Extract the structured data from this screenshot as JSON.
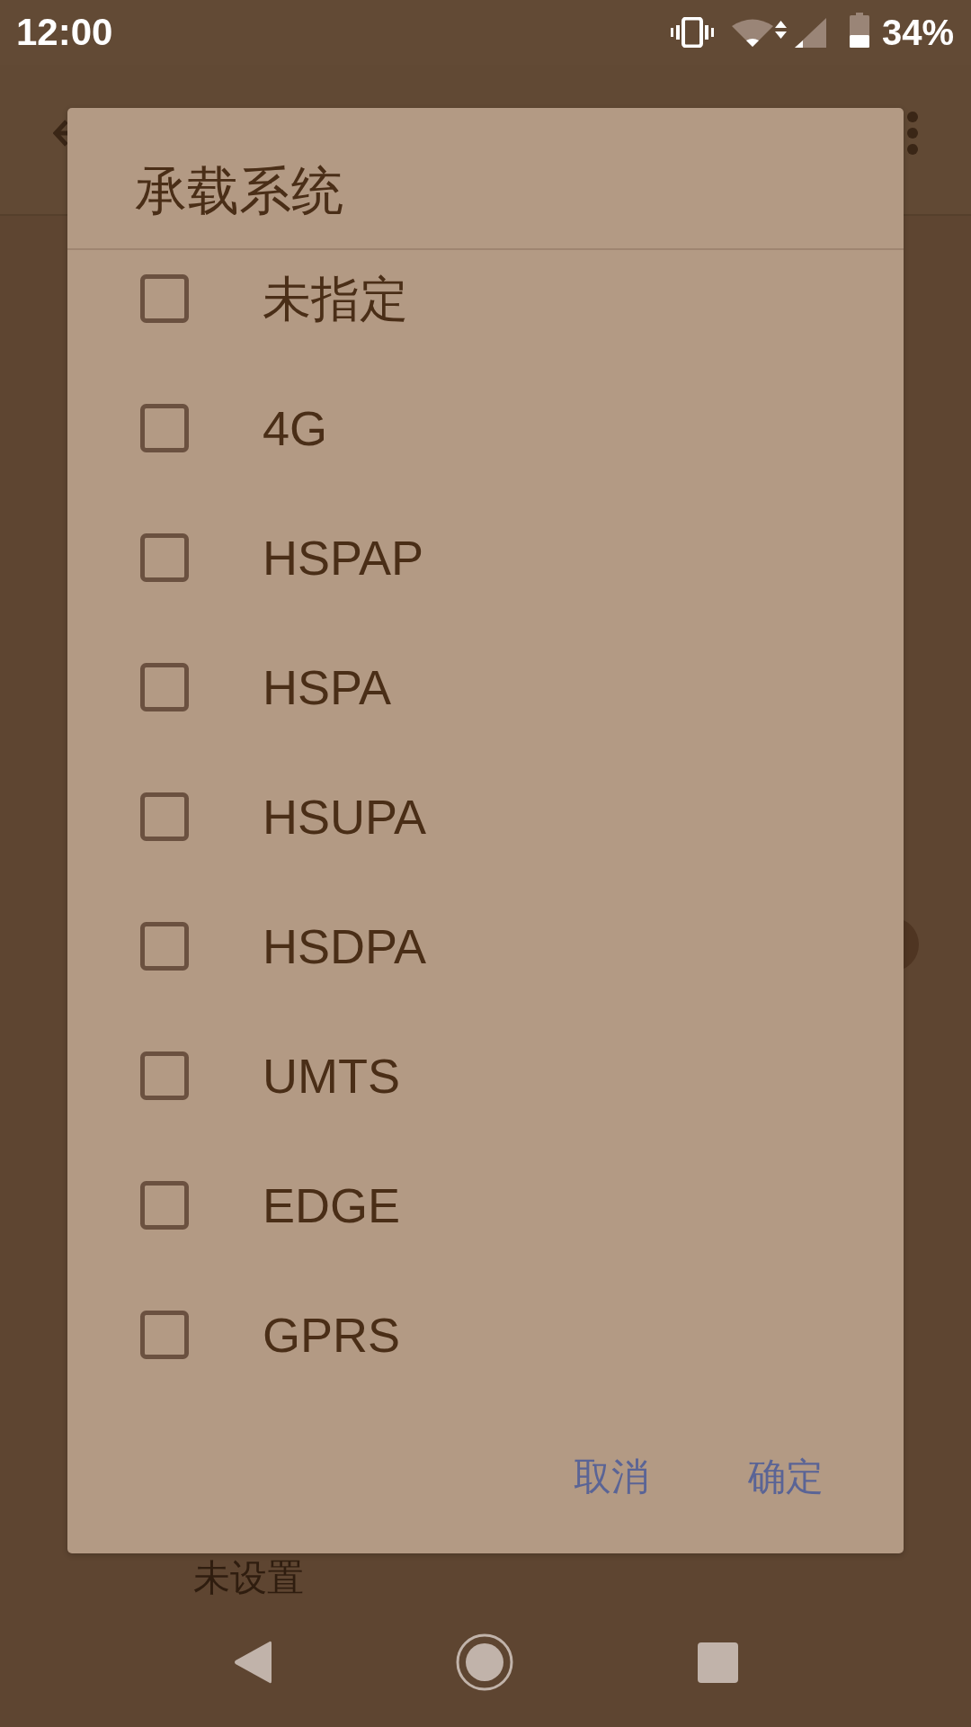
{
  "status_bar": {
    "time": "12:00",
    "battery": "34%"
  },
  "background": {
    "summary": "未设置"
  },
  "dialog": {
    "title": "承载系统",
    "options": [
      {
        "label": "未指定",
        "checked": false
      },
      {
        "label": "4G",
        "checked": false
      },
      {
        "label": "HSPAP",
        "checked": false
      },
      {
        "label": "HSPA",
        "checked": false
      },
      {
        "label": "HSUPA",
        "checked": false
      },
      {
        "label": "HSDPA",
        "checked": false
      },
      {
        "label": "UMTS",
        "checked": false
      },
      {
        "label": "EDGE",
        "checked": false
      },
      {
        "label": "GPRS",
        "checked": false
      }
    ],
    "buttons": [
      "取消",
      "确定"
    ]
  }
}
